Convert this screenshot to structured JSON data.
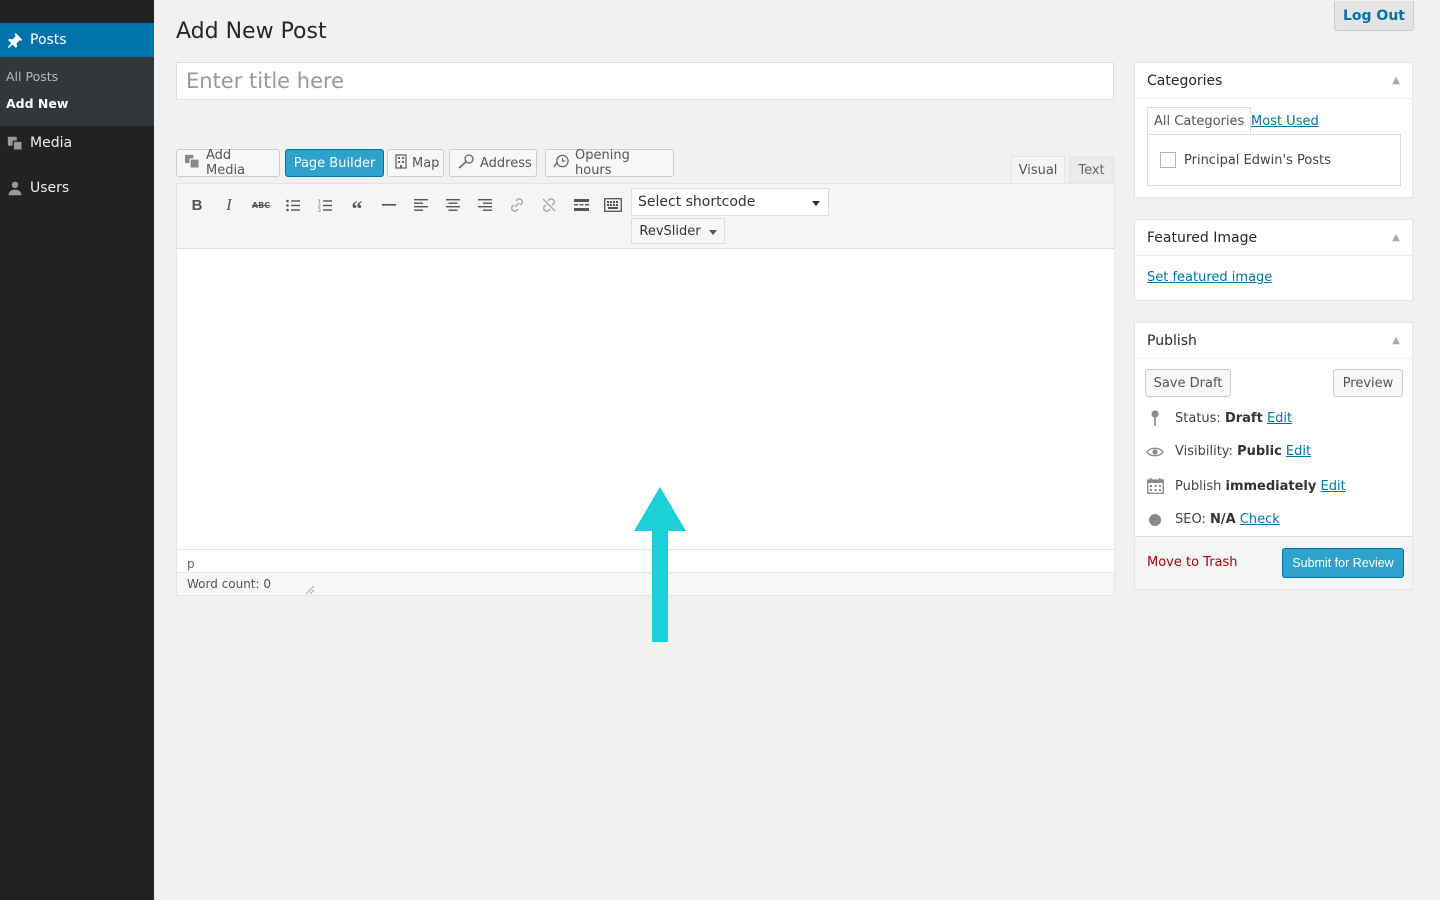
{
  "sidebar": {
    "posts_label": "Posts",
    "submenu": [
      "All Posts",
      "Add New"
    ],
    "media_label": "Media",
    "users_label": "Users"
  },
  "header": {
    "title": "Add New Post",
    "logout_label": "Log Out"
  },
  "title_input": {
    "placeholder": "Enter title here",
    "value": ""
  },
  "media_buttons": {
    "add_media": "Add Media",
    "page_builder": "Page Builder",
    "map": "Map",
    "address": "Address",
    "opening_hours": "Opening hours"
  },
  "editor_tabs": {
    "visual": "Visual",
    "text": "Text",
    "active": "visual"
  },
  "toolbar": {
    "shortcode_select": "Select shortcode",
    "revslider": "RevSlider"
  },
  "editor": {
    "path": "p",
    "word_count": "Word count: 0"
  },
  "categories": {
    "title": "Categories",
    "tab_all": "All Categories",
    "tab_most_used": "Most Used",
    "items": [
      "Principal Edwin's Posts"
    ]
  },
  "featured_image": {
    "title": "Featured Image",
    "link": "Set featured image"
  },
  "publish": {
    "title": "Publish",
    "save_draft": "Save Draft",
    "preview": "Preview",
    "status_label": "Status:",
    "status_value": "Draft",
    "visibility_label": "Visibility:",
    "visibility_value": "Public",
    "publish_label": "Publish",
    "publish_value": "immediately",
    "seo_label": "SEO:",
    "seo_value": "N/A",
    "edit": "Edit",
    "check": "Check",
    "trash": "Move to Trash",
    "submit": "Submit for Review"
  },
  "colors": {
    "accent": "#0073aa",
    "button_primary": "#2ea2cc",
    "arrow": "#1bd0d6",
    "sidebar_bg": "#222222"
  }
}
